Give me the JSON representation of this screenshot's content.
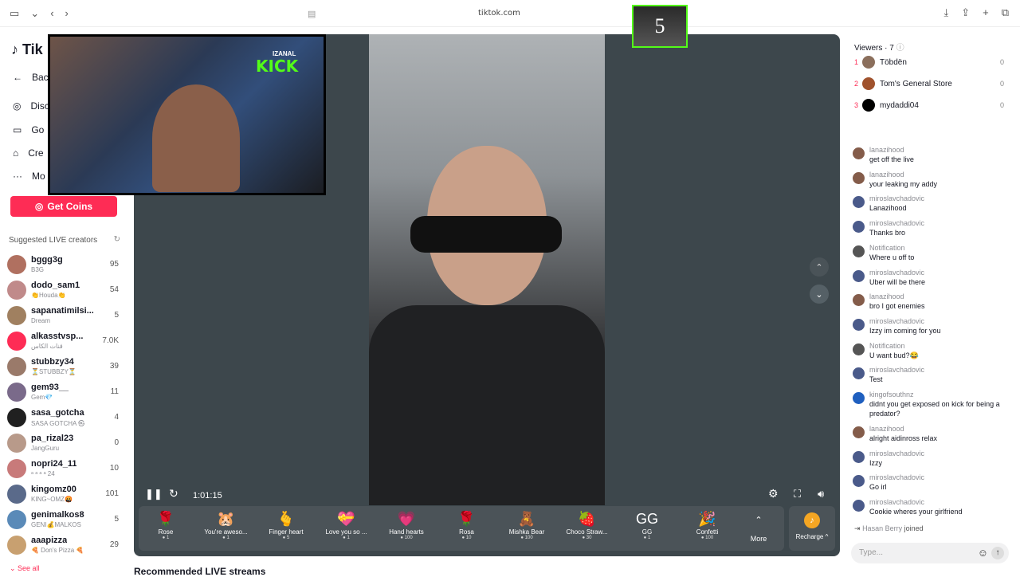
{
  "browser": {
    "url": "tiktok.com"
  },
  "sidebar": {
    "logo": "Tik",
    "nav": [
      "Bac",
      "Disc",
      "Go",
      "Cre",
      "Mo"
    ],
    "get_coins": "Get Coins",
    "suggested_title": "Suggested LIVE creators",
    "creators": [
      {
        "name": "bggg3g",
        "sub": "B3G",
        "count": "95"
      },
      {
        "name": "dodo_sam1",
        "sub": "👏Houda👏",
        "count": "54"
      },
      {
        "name": "sapanatimilsi...",
        "sub": "Dream",
        "count": "5"
      },
      {
        "name": "alkasstvsp...",
        "sub": "قنات الكاس",
        "count": "7.0K"
      },
      {
        "name": "stubbzy34",
        "sub": "⏳STUBBZY⏳",
        "count": "39"
      },
      {
        "name": "gem93__",
        "sub": "Gem💎",
        "count": "11"
      },
      {
        "name": "sasa_gotcha",
        "sub": "SASA GOTCHA ㉿",
        "count": "4"
      },
      {
        "name": "pa_rizal23",
        "sub": "JangGuru",
        "count": "0"
      },
      {
        "name": "nopri24_11",
        "sub": "ᵃ ᵃ ᵃ ᵃ 24",
        "count": "10"
      },
      {
        "name": "kingomz00",
        "sub": "KING~OMZ🤬",
        "count": "101"
      },
      {
        "name": "genimalkos8",
        "sub": "GENI💰MALKOS",
        "count": "5"
      },
      {
        "name": "aaapizza",
        "sub": "🍕 Don's Pizza 🍕",
        "count": "29"
      }
    ],
    "see_all": "See all"
  },
  "overlay": {
    "tag": "IZANAL",
    "brand": "KICK"
  },
  "badge": "5",
  "player": {
    "time": "1:01:15",
    "gifts": [
      {
        "name": "Rose",
        "price": "1",
        "icon": "🌹"
      },
      {
        "name": "You're aweso...",
        "price": "1",
        "icon": "🐹"
      },
      {
        "name": "Finger heart",
        "price": "5",
        "icon": "🫰"
      },
      {
        "name": "Love you so ...",
        "price": "1",
        "icon": "💝"
      },
      {
        "name": "Hand hearts",
        "price": "100",
        "icon": "💗"
      },
      {
        "name": "Rosa",
        "price": "10",
        "icon": "🌹"
      },
      {
        "name": "Mishka Bear",
        "price": "100",
        "icon": "🧸"
      },
      {
        "name": "Choco Straw...",
        "price": "30",
        "icon": "🍓"
      },
      {
        "name": "GG",
        "price": "1",
        "icon": "GG"
      },
      {
        "name": "Confetti",
        "price": "100",
        "icon": "🎉"
      }
    ],
    "more": "More",
    "recharge": "Recharge ^"
  },
  "recommended": "Recommended LIVE streams",
  "viewers": {
    "title": "Viewers · 7",
    "list": [
      {
        "rank": "1",
        "name": "Töbdën",
        "count": "0"
      },
      {
        "rank": "2",
        "name": "Tom's General Store",
        "count": "0"
      },
      {
        "rank": "3",
        "name": "mydaddi04",
        "count": "0"
      }
    ]
  },
  "chat": [
    {
      "user": "lanazihood",
      "text": "get off the live"
    },
    {
      "user": "lanazihood",
      "text": "your leaking my addy"
    },
    {
      "user": "miroslavchadovic",
      "text": "Lanazihood"
    },
    {
      "user": "miroslavchadovic",
      "text": "Thanks bro"
    },
    {
      "user": "Notification",
      "text": "Where u off to"
    },
    {
      "user": "miroslavchadovic",
      "text": "Uber will be there"
    },
    {
      "user": "lanazihood",
      "text": "bro I got enemies"
    },
    {
      "user": "miroslavchadovic",
      "text": "Izzy im coming for you"
    },
    {
      "user": "Notification",
      "text": "U want bud?😂"
    },
    {
      "user": "miroslavchadovic",
      "text": "Test"
    },
    {
      "user": "kingofsouthnz",
      "text": "didnt you get exposed on kick for being a predator?"
    },
    {
      "user": "lanazihood",
      "text": "alright aidinross relax"
    },
    {
      "user": "miroslavchadovic",
      "text": "Izzy"
    },
    {
      "user": "miroslavchadovic",
      "text": "Go irl"
    },
    {
      "user": "miroslavchadovic",
      "text": "Cookie wheres your girlfriend"
    }
  ],
  "joined": {
    "user": "Hasan Berry",
    "text": "joined"
  },
  "chat_input": {
    "placeholder": "Type..."
  }
}
